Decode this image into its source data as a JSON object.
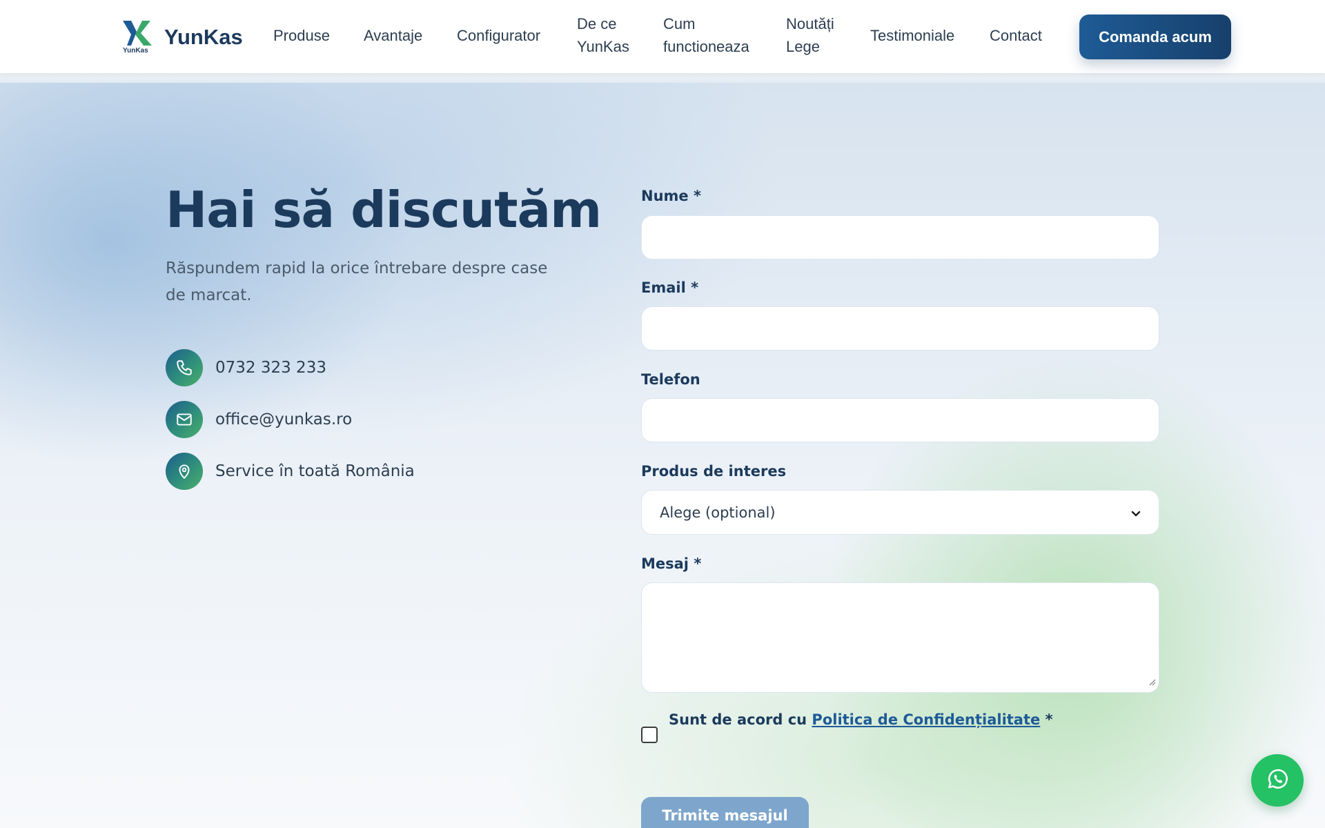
{
  "header": {
    "logo_text": "YunKas",
    "logo_mark_text": "YunKas",
    "nav": [
      {
        "line1": "Produse",
        "line2": ""
      },
      {
        "line1": "Avantaje",
        "line2": ""
      },
      {
        "line1": "Configurator",
        "line2": ""
      },
      {
        "line1": "De ce",
        "line2": "YunKas"
      },
      {
        "line1": "Cum",
        "line2": "functioneaza"
      },
      {
        "line1": "Noutăți",
        "line2": "Lege"
      },
      {
        "line1": "Testimoniale",
        "line2": ""
      },
      {
        "line1": "Contact",
        "line2": ""
      }
    ],
    "cta_label": "Comanda acum"
  },
  "hero": {
    "title": "Hai să discutăm",
    "subtitle": "Răspundem rapid la orice întrebare despre case de marcat.",
    "contacts": [
      {
        "icon": "phone-icon",
        "text": "0732 323 233"
      },
      {
        "icon": "mail-icon",
        "text": "office@yunkas.ro"
      },
      {
        "icon": "location-pin-icon",
        "text": "Service în toată România"
      }
    ]
  },
  "form": {
    "name_label": "Nume *",
    "email_label": "Email *",
    "phone_label": "Telefon",
    "product_label": "Produs de interes",
    "product_selected": "Alege (optional)",
    "message_label": "Mesaj *",
    "consent_prefix": "Sunt de acord cu ",
    "consent_link": "Politica de Confidențialitate",
    "consent_suffix": " *",
    "submit_label": "Trimite mesajul"
  },
  "colors": {
    "brand_navy": "#1b3a5c",
    "brand_blue": "#1e5b96",
    "brand_green": "#4caf6a",
    "whatsapp_green": "#25c165"
  },
  "icons": {
    "whatsapp": "whatsapp-icon",
    "select_arrow": "chevron-down-icon"
  }
}
